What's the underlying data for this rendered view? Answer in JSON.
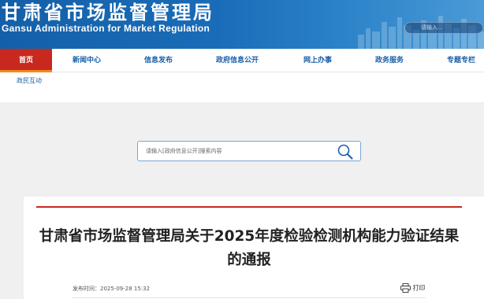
{
  "header": {
    "title": "甘肃省市场监督管理局",
    "subtitle": "Gansu Administration for Market Regulation",
    "search_placeholder": "请输入..."
  },
  "nav": {
    "items": [
      {
        "label": "首页",
        "active": true
      },
      {
        "label": "新闻中心"
      },
      {
        "label": "信息发布"
      },
      {
        "label": "政府信息公开"
      },
      {
        "label": "网上办事"
      },
      {
        "label": "政务服务"
      },
      {
        "label": "专题专栏"
      }
    ],
    "sub_items": [
      {
        "label": "政民互动"
      }
    ]
  },
  "search": {
    "placeholder": "请输入[政府信息公开]搜索内容",
    "icon": "search-icon"
  },
  "article": {
    "title": "甘肃省市场监督管理局关于2025年度检验检测机构能力验证结果的通报",
    "published_label": "发布时间：",
    "published_time": "2025-09-28 15:32",
    "print_label": "打印",
    "print_icon": "printer-icon"
  },
  "colors": {
    "header_blue": "#1a6cb8",
    "nav_active_red": "#c8281e",
    "nav_underline_orange": "#f08a1c",
    "nav_text_blue": "#1a5fa8",
    "title_rule_red": "#c8281e"
  }
}
